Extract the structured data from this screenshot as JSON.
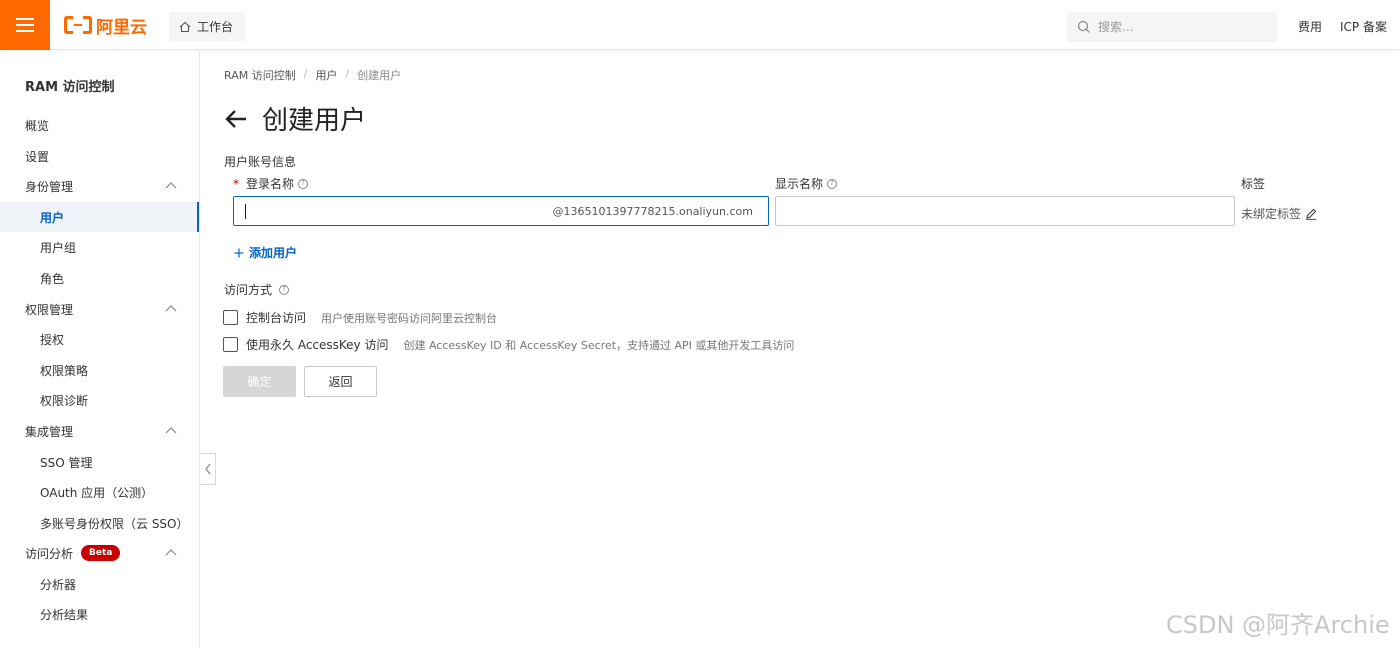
{
  "topbar": {
    "logo_text": "阿里云",
    "workbench_label": "工作台",
    "search_placeholder": "搜索...",
    "links": [
      "费用",
      "ICP 备案"
    ],
    "accent": "#ff6a00"
  },
  "sidebar": {
    "title": "RAM 访问控制",
    "items": [
      {
        "label": "概览",
        "level": "top"
      },
      {
        "label": "设置",
        "level": "top"
      },
      {
        "label": "身份管理",
        "level": "top",
        "expanded": true
      },
      {
        "label": "用户",
        "level": "sub",
        "active": true
      },
      {
        "label": "用户组",
        "level": "sub"
      },
      {
        "label": "角色",
        "level": "sub"
      },
      {
        "label": "权限管理",
        "level": "top",
        "expanded": true
      },
      {
        "label": "授权",
        "level": "sub"
      },
      {
        "label": "权限策略",
        "level": "sub"
      },
      {
        "label": "权限诊断",
        "level": "sub"
      },
      {
        "label": "集成管理",
        "level": "top",
        "expanded": true
      },
      {
        "label": "SSO 管理",
        "level": "sub"
      },
      {
        "label": "OAuth 应用（公测）",
        "level": "sub"
      },
      {
        "label": "多账号身份权限（云 SSO）",
        "level": "sub"
      },
      {
        "label": "访问分析",
        "level": "top",
        "expanded": true,
        "badge": "Beta"
      },
      {
        "label": "分析器",
        "level": "sub"
      },
      {
        "label": "分析结果",
        "level": "sub"
      }
    ],
    "active_color": "#0064c8"
  },
  "breadcrumb": [
    "RAM 访问控制",
    "用户",
    "创建用户"
  ],
  "page_title": "创建用户",
  "form": {
    "section_title": "用户账号信息",
    "login_name_label": "登录名称",
    "login_name_value": "",
    "login_name_suffix": "@1365101397778215.onaliyun.com",
    "display_name_label": "显示名称",
    "display_name_value": "",
    "tag_label": "标签",
    "tag_value": "未绑定标签",
    "add_user": "添加用户",
    "access_label": "访问方式",
    "access_options": [
      {
        "label": "控制台访问",
        "desc": "用户使用账号密码访问阿里云控制台",
        "checked": false
      },
      {
        "label": "使用永久 AccessKey 访问",
        "desc": "创建 AccessKey ID 和 AccessKey Secret，支持通过 API 或其他开发工具访问",
        "checked": false
      }
    ],
    "ok_button": "确定",
    "back_button": "返回"
  },
  "watermark": "CSDN @阿齐Archie"
}
